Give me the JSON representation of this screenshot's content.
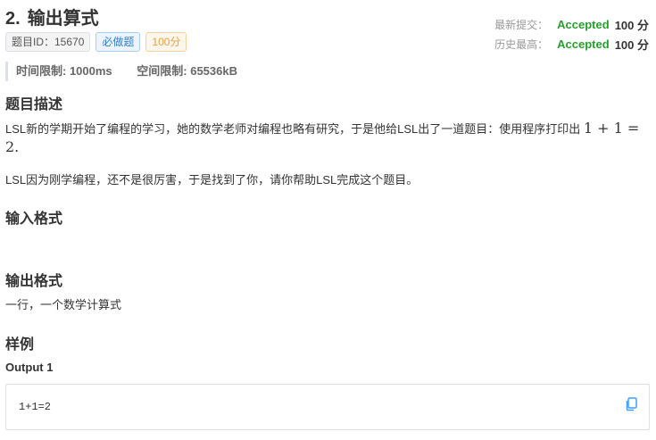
{
  "problem": {
    "number": "2.",
    "title": "输出算式",
    "tags": {
      "id": "题目ID：15670",
      "required": "必做题",
      "score": "100分"
    }
  },
  "status": {
    "latest_label": "最新提交：",
    "latest_result": "Accepted",
    "latest_score": "100 分",
    "best_label": "历史最高：",
    "best_result": "Accepted",
    "best_score": "100 分"
  },
  "limits": {
    "time": "时间限制: 1000ms",
    "memory": "空间限制: 65536kB"
  },
  "sections": {
    "description": "题目描述",
    "input": "输入格式",
    "output": "输出格式",
    "sample": "样例"
  },
  "description": {
    "p1_text": "LSL新的学期开始了编程的学习，她的数学老师对编程也略有研究，于是他给LSL出了一道题目：使用程序打印出 ",
    "p1_math": "1 + 1 = 2.",
    "p2": "LSL因为刚学编程，还不是很厉害，于是找到了你，请你帮助LSL完成这个题目。"
  },
  "output_format": "一行，一个数学计算式",
  "sample": {
    "label": "Output 1",
    "content": "1+1=2"
  },
  "colors": {
    "accepted": "#25a12a",
    "copy_icon": "#409eff"
  }
}
